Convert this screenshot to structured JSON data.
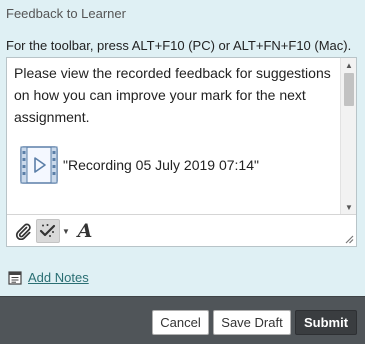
{
  "section_title": "Feedback to Learner",
  "toolbar_hint": "For the toolbar, press ALT+F10 (PC) or ALT+FN+F10 (Mac).",
  "editor": {
    "text": "Please view the recorded feedback for suggestions on how you can improve your mark for the next assignment.",
    "recording_label": "\"Recording 05 July 2019 07:14\"",
    "recording_icon": "video-file-icon"
  },
  "toolbar_icons": [
    "paperclip-icon",
    "magic-wand-icon",
    "chevron-down-icon",
    "font-style-icon"
  ],
  "notes": {
    "link_label": "Add Notes",
    "icon": "add-notes-icon"
  },
  "footer": {
    "cancel_label": "Cancel",
    "save_draft_label": "Save Draft",
    "submit_label": "Submit"
  },
  "colors": {
    "page_bg": "#dff0f4",
    "footer_bg": "#505559",
    "link": "#2a6f73",
    "submit_bg": "#3a3d40"
  }
}
